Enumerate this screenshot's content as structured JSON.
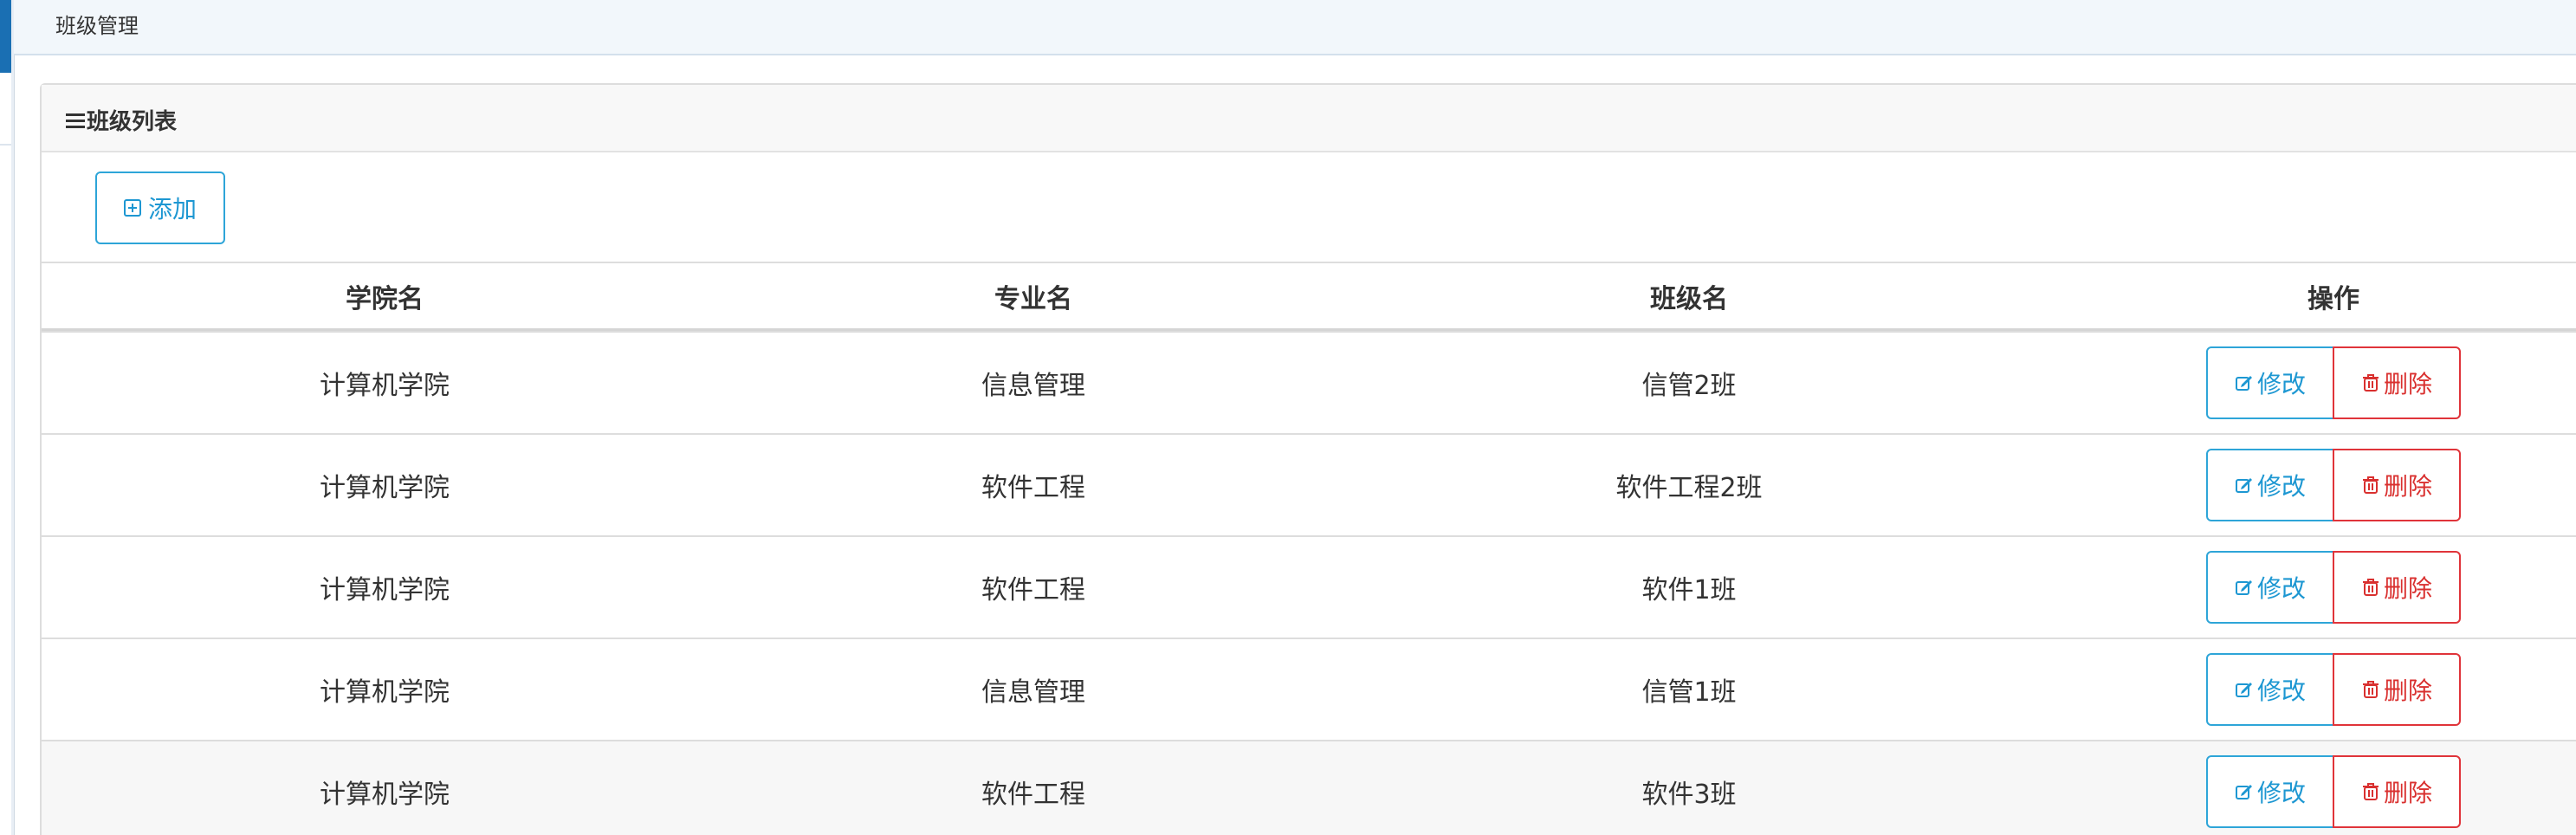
{
  "breadcrumb": "班级管理",
  "panel": {
    "title": "班级列表",
    "add_label": "添加"
  },
  "table": {
    "headers": [
      "学院名",
      "专业名",
      "班级名",
      "操作"
    ],
    "rows": [
      {
        "college": "计算机学院",
        "major": "信息管理",
        "class": "信管2班"
      },
      {
        "college": "计算机学院",
        "major": "软件工程",
        "class": "软件工程2班"
      },
      {
        "college": "计算机学院",
        "major": "软件工程",
        "class": "软件1班"
      },
      {
        "college": "计算机学院",
        "major": "信息管理",
        "class": "信管1班"
      },
      {
        "college": "计算机学院",
        "major": "软件工程",
        "class": "软件3班"
      }
    ],
    "edit_label": "修改",
    "delete_label": "删除"
  },
  "icons": {
    "menu": "bars-icon",
    "add": "plus-square-icon",
    "edit": "edit-icon",
    "delete": "trash-icon"
  },
  "colors": {
    "primary": "#1d97d2",
    "danger": "#d9302f",
    "sidebar_accent": "#1a6fb3"
  }
}
